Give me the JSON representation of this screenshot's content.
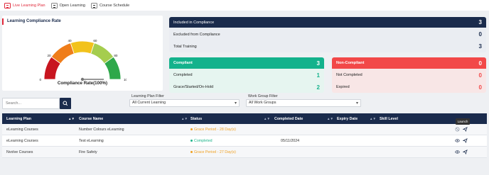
{
  "nav": {
    "items": [
      {
        "label": "Live Learning Plan",
        "active": true
      },
      {
        "label": "Open Learning",
        "active": false
      },
      {
        "label": "Course Schedule",
        "active": false
      }
    ]
  },
  "rate_card": {
    "title": "Learning Compliance Rate",
    "gauge_label": "Compliance Rate(100%)",
    "gauge_value_percent": 100,
    "ticks": [
      "0",
      "20",
      "40",
      "60",
      "80",
      "100"
    ],
    "colors": [
      "#c8151f",
      "#ef7d1a",
      "#f2c21b",
      "#a5cd4e",
      "#2ea84a"
    ]
  },
  "summary": {
    "included_label": "Included in Compliance",
    "included_value": "3",
    "excluded_label": "Excluded from Compliance",
    "excluded_value": "0",
    "total_label": "Total Training",
    "total_value": "3"
  },
  "compliant": {
    "head_label": "Compliant",
    "head_value": "3",
    "completed_label": "Completed",
    "completed_value": "1",
    "grace_label": "Grace/Started/On-Hold",
    "grace_value": "2"
  },
  "noncompliant": {
    "head_label": "Non-Compliant",
    "head_value": "0",
    "notcompleted_label": "Not Completed",
    "notcompleted_value": "0",
    "expired_label": "Expired",
    "expired_value": "0"
  },
  "filters": {
    "search_placeholder": "Search...",
    "plan_filter_label": "Learning Plan Filter",
    "plan_filter_value": "All Current Learning",
    "group_filter_label": "Work Group Filter",
    "group_filter_value": "All Work Groups"
  },
  "table": {
    "columns": [
      "Learning Plan",
      "Course Name",
      "Status",
      "Completed Date",
      "Expiry Date",
      "Skill Level"
    ],
    "rows": [
      {
        "plan": "eLearning Courses",
        "course": "Number Colours eLearning",
        "status": "Grace Period - 28 Day(s)",
        "status_type": "grace",
        "completed": "",
        "expiry": ""
      },
      {
        "plan": "eLearning Courses",
        "course": "Test eLearning",
        "status": "Completed",
        "status_type": "done",
        "completed": "05/11/2024",
        "expiry": ""
      },
      {
        "plan": "Nvolve Courses",
        "course": "Fire Safety",
        "status": "Grace Period - 27 Day(s)",
        "status_type": "grace",
        "completed": "",
        "expiry": ""
      }
    ],
    "tooltip": "Launch"
  }
}
